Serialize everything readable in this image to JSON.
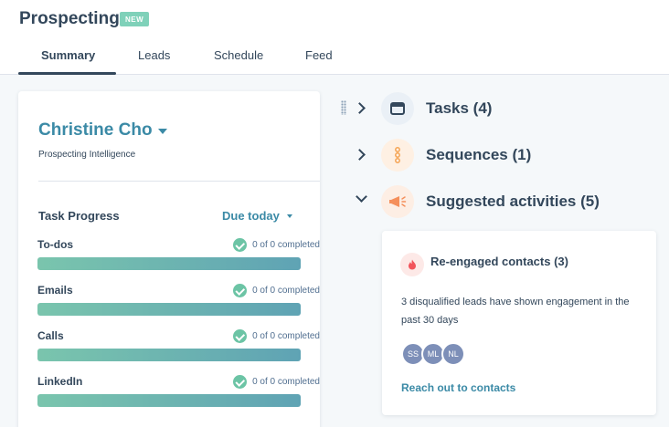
{
  "header": {
    "title": "Prospecting",
    "badge": "NEW",
    "tabs": [
      {
        "label": "Summary",
        "active": true
      },
      {
        "label": "Leads",
        "active": false
      },
      {
        "label": "Schedule",
        "active": false
      },
      {
        "label": "Feed",
        "active": false
      }
    ]
  },
  "owner": {
    "name": "Christine Cho",
    "subtitle": "Prospecting Intelligence"
  },
  "task_progress": {
    "title": "Task Progress",
    "filter": "Due today",
    "rows": [
      {
        "label": "To-dos",
        "status": "0 of 0 completed",
        "progress": 1.0
      },
      {
        "label": "Emails",
        "status": "0 of 0 completed",
        "progress": 1.0
      },
      {
        "label": "Calls",
        "status": "0 of 0 completed",
        "progress": 1.0
      },
      {
        "label": "LinkedIn",
        "status": "0 of 0 completed",
        "progress": 1.0
      }
    ]
  },
  "sections": [
    {
      "title": "Tasks (4)",
      "expanded": false,
      "icon": "calendar-icon"
    },
    {
      "title": "Sequences (1)",
      "expanded": false,
      "icon": "sequence-icon"
    },
    {
      "title": "Suggested activities (5)",
      "expanded": true,
      "icon": "megaphone-icon"
    }
  ],
  "suggestion": {
    "title": "Re-engaged contacts (3)",
    "description": "3 disqualified leads have shown engagement in the past 30 days",
    "avatars": [
      "SS",
      "ML",
      "NL"
    ],
    "link": "Reach out to contacts"
  },
  "colors": {
    "accent": "#3b8aa6",
    "badge": "#7fd1b9",
    "check": "#6cc4a5",
    "text": "#33475b"
  }
}
